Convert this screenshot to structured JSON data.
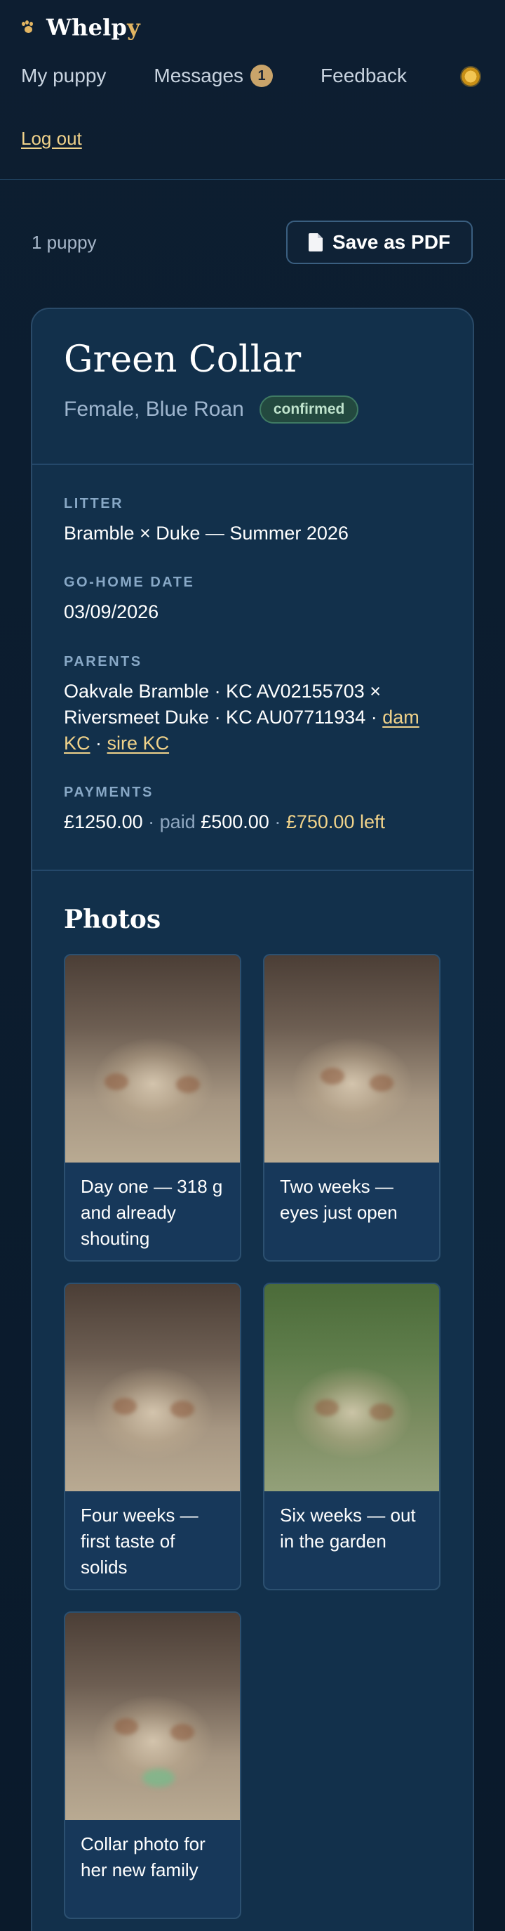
{
  "brand": {
    "name_main": "Whelp",
    "name_accent": "y"
  },
  "nav": {
    "items": [
      {
        "label": "My puppy"
      },
      {
        "label": "Messages",
        "badge": "1"
      },
      {
        "label": "Feedback"
      }
    ],
    "logout": "Log out",
    "theme_icon": "sun-icon"
  },
  "toolbar": {
    "count": "1 puppy",
    "pdf_label": "Save as PDF",
    "pdf_icon": "document-icon"
  },
  "puppy": {
    "name": "Green Collar",
    "description": "Female, Blue Roan",
    "status": "confirmed",
    "litter_label": "LITTER",
    "litter": "Bramble × Duke — Summer 2026",
    "gohome_label": "GO-HOME DATE",
    "gohome": "03/09/2026",
    "parents_label": "PARENTS",
    "parents_text": "Oakvale Bramble · KC AV02155703 × Riversmeet Duke · KC AU07711934 ·",
    "dam_link": "dam KC",
    "sep": "·",
    "sire_link": "sire KC",
    "payments_label": "PAYMENTS",
    "total": "£1250.00",
    "dot1": "·",
    "paid_label": "paid",
    "paid": "£500.00",
    "dot2": "·",
    "left": "£750.00 left"
  },
  "photos": {
    "title": "Photos",
    "items": [
      {
        "caption": "Day one — 318 g and already shouting"
      },
      {
        "caption": "Two weeks — eyes just open"
      },
      {
        "caption": "Four weeks — first taste of solids"
      },
      {
        "caption": "Six weeks — out in the garden"
      },
      {
        "caption": "Collar photo for her new family"
      }
    ]
  },
  "colors": {
    "accent": "#e2b562",
    "link": "#f0d28a",
    "background": "#0b1b2d",
    "card": "#12304b",
    "status_bg": "#23493f"
  }
}
